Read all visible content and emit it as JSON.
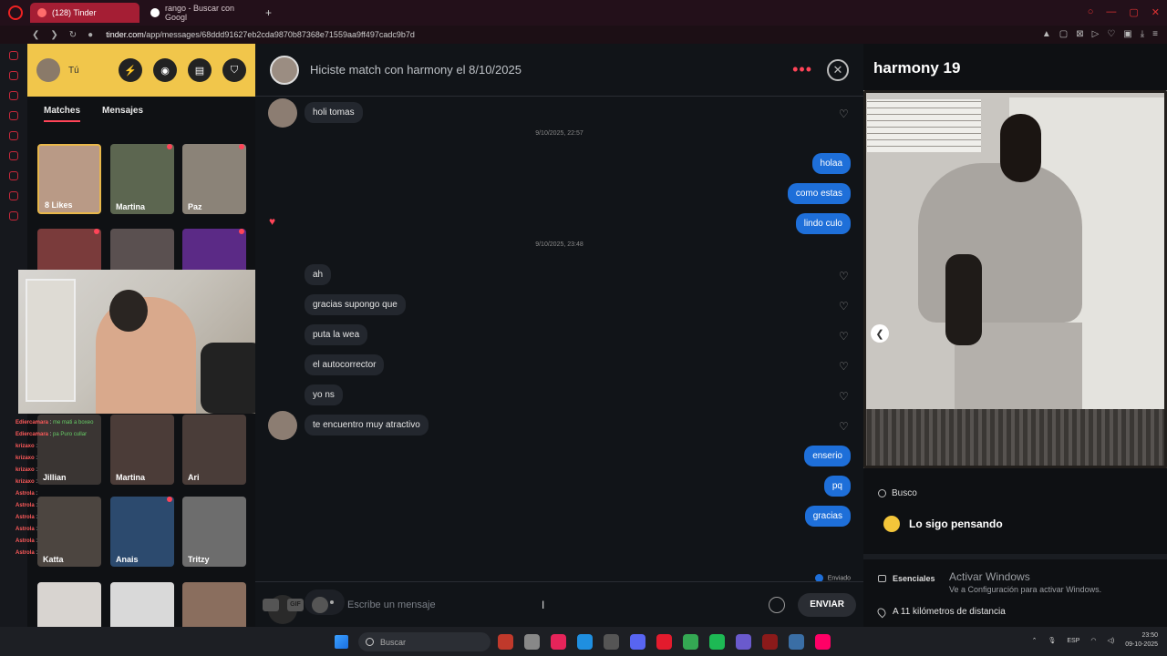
{
  "browser": {
    "tabs": [
      {
        "title": "(128) Tinder",
        "active": true
      },
      {
        "title": "rango - Buscar con Googl",
        "active": false
      }
    ],
    "url_host": "tinder.com",
    "url_path": "/app/messages/68ddd91627eb2cda9870b87368e71559aa9ff497cadc9b7d"
  },
  "left_panel": {
    "user_label": "Tú",
    "tabs": [
      "Matches",
      "Mensajes"
    ],
    "matches": [
      {
        "name": "8 Likes",
        "color": "#b99a86",
        "dot": false
      },
      {
        "name": "Martina",
        "color": "#5c6650",
        "dot": true
      },
      {
        "name": "Paz",
        "color": "#8b8378",
        "dot": true
      },
      {
        "name": "",
        "color": "#7a3b3b",
        "dot": true
      },
      {
        "name": "",
        "color": "#5a5050",
        "dot": false
      },
      {
        "name": "",
        "color": "#5b2a86",
        "dot": true
      },
      {
        "name": "Jillian",
        "color": "#3a3533",
        "dot": false
      },
      {
        "name": "Martina",
        "color": "#4b3c38",
        "dot": false
      },
      {
        "name": "Ari",
        "color": "#4a3d39",
        "dot": false
      },
      {
        "name": "Katta",
        "color": "#4c4540",
        "dot": false
      },
      {
        "name": "Anais",
        "color": "#2c4a6e",
        "dot": true
      },
      {
        "name": "Tritzy",
        "color": "#6d6d6d",
        "dot": false
      },
      {
        "name": "",
        "color": "#d8d4d0",
        "dot": false
      },
      {
        "name": "",
        "color": "#d9d9d9",
        "dot": false
      },
      {
        "name": "",
        "color": "#8a6e5e",
        "dot": false
      }
    ]
  },
  "stream_chat": [
    {
      "user": "Ediercamara",
      "text": "me mati a boxeo"
    },
    {
      "user": "Ediercamara",
      "text": "pa Puro cullar"
    },
    {
      "user": "krizaxo",
      "text": ""
    },
    {
      "user": "krizaxo",
      "text": ""
    },
    {
      "user": "krizaxo",
      "text": ""
    },
    {
      "user": "krizaxo",
      "text": ""
    },
    {
      "user": "Astrola",
      "text": ""
    },
    {
      "user": "Astrola",
      "text": ""
    },
    {
      "user": "Astrola",
      "text": ""
    },
    {
      "user": "Astrola",
      "text": ""
    },
    {
      "user": "Astrola",
      "text": ""
    },
    {
      "user": "Astrola",
      "text": ""
    }
  ],
  "conversation": {
    "title": "Hiciste match con harmony el 8/10/2025",
    "messages": [
      {
        "dir": "in",
        "text": "holi tomas"
      },
      {
        "dir": "time",
        "text": "9/10/2025, 22:57"
      },
      {
        "dir": "out",
        "text": "holaa"
      },
      {
        "dir": "out",
        "text": "como estas"
      },
      {
        "dir": "out",
        "text": "lindo culo"
      },
      {
        "dir": "time",
        "text": "9/10/2025, 23:48"
      },
      {
        "dir": "in",
        "text": "ah"
      },
      {
        "dir": "in",
        "text": "gracias supongo que"
      },
      {
        "dir": "in",
        "text": "puta la wea"
      },
      {
        "dir": "in",
        "text": "el autocorrector"
      },
      {
        "dir": "in",
        "text": "yo ns"
      },
      {
        "dir": "in",
        "text": "te encuentro muy atractivo"
      },
      {
        "dir": "out",
        "text": "enserio"
      },
      {
        "dir": "out",
        "text": "pq"
      },
      {
        "dir": "out",
        "text": "gracias"
      }
    ],
    "sent_label": "Enviado",
    "input_placeholder": "Escribe un mensaje",
    "send_label": "ENVIAR",
    "gif_label": "GIF"
  },
  "profile": {
    "name": "harmony 19",
    "looking_for_label": "Busco",
    "looking_for_value": "Lo sigo pensando",
    "essentials_label": "Esenciales",
    "distance": "A 11 kilómetros de distancia"
  },
  "windows_activation": {
    "line1": "Activar Windows",
    "line2": "Ve a Configuración para activar Windows."
  },
  "taskbar": {
    "search_placeholder": "Buscar",
    "language": "ESP",
    "time": "23:50",
    "date": "09-10-2025"
  }
}
